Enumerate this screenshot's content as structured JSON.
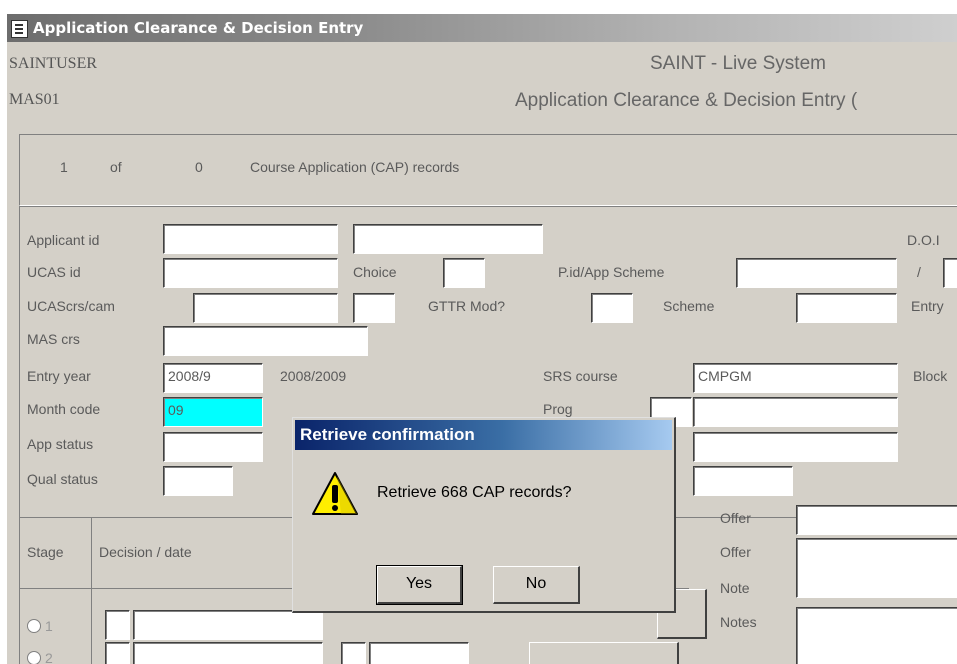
{
  "window": {
    "title": "Application Clearance & Decision Entry"
  },
  "header": {
    "user": "SAINTUSER",
    "form": "MAS01",
    "system": "SAINT - Live System",
    "form_title": "Application Clearance & Decision Entry ("
  },
  "records": {
    "current": "1",
    "of": "of",
    "total": "0",
    "label": "Course Application (CAP) records"
  },
  "labels": {
    "applicant_id": "Applicant id",
    "ucas_id": "UCAS id",
    "ucascrs": "UCAScrs/cam",
    "mas_crs": "MAS crs",
    "entry_year": "Entry year",
    "month_code": "Month code",
    "app_status": "App status",
    "qual_status": "Qual status",
    "choice": "Choice",
    "gttr_mod": "GTTR Mod?",
    "pid_scheme": "P.id/App Scheme",
    "scheme": "Scheme",
    "srs_course": "SRS course",
    "prog": "Prog",
    "dob": "D.O.I",
    "slash": "/",
    "entry": "Entry",
    "block": "Block",
    "offer1": "Offer",
    "offer2": "Offer",
    "note": "Note",
    "notes": "Notes",
    "stage": "Stage",
    "decision_date": "Decision / date"
  },
  "values": {
    "entry_year": "2008/9",
    "entry_year_full": "2008/2009",
    "month_code": "09",
    "srs_course": "CMPGM"
  },
  "stages": [
    "1",
    "2"
  ],
  "dialog": {
    "title": "Retrieve confirmation",
    "message": "Retrieve 668 CAP records?",
    "yes": "Yes",
    "no": "No",
    "icon": "warning-icon"
  },
  "colors": {
    "highlight_field": "#00ffff",
    "dialog_title": "#0a246a"
  }
}
